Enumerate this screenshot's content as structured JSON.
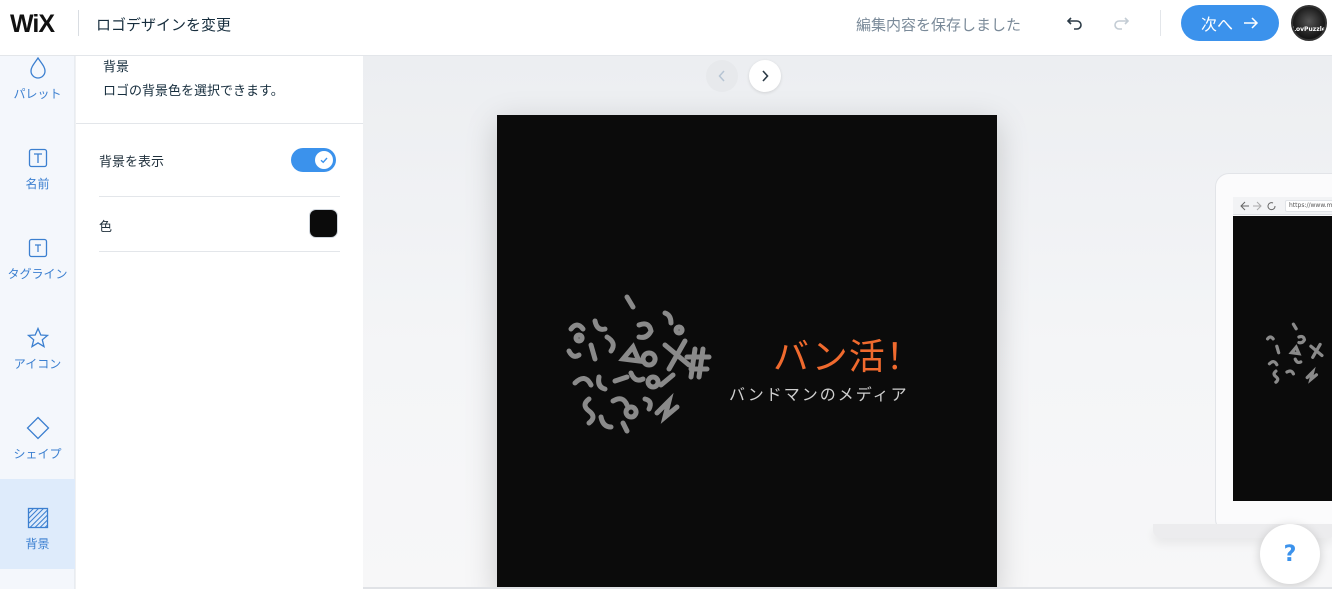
{
  "app": {
    "logo_text": "WiX",
    "page_title": "ロゴデザインを変更"
  },
  "header": {
    "save_status": "編集内容を保存しました",
    "next_label": "次へ",
    "avatar_text": "LovPuzzle"
  },
  "rail": {
    "items": [
      {
        "label": "パレット",
        "icon": "drop-icon"
      },
      {
        "label": "名前",
        "icon": "text-box-icon"
      },
      {
        "label": "タグライン",
        "icon": "text-box-icon"
      },
      {
        "label": "アイコン",
        "icon": "star-icon"
      },
      {
        "label": "シェイプ",
        "icon": "diamond-icon"
      },
      {
        "label": "背景",
        "icon": "hatched-square-icon",
        "active": true
      }
    ]
  },
  "panel": {
    "title": "背景",
    "description": "ロゴの背景色を選択できます。",
    "show_background_label": "背景を表示",
    "show_background_enabled": true,
    "color_label": "色",
    "color_value": "#0b0b0b"
  },
  "preview": {
    "brand_name": "バン活！",
    "tagline": "バンドマンのメディア",
    "browser_url": "https://www.my",
    "help_label": "?"
  },
  "colors": {
    "accent": "#3b92ec",
    "brand_orange": "#f06a2e",
    "logo_bg": "#0b0b0b"
  }
}
